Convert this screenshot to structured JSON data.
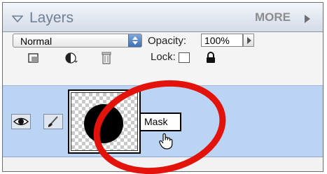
{
  "panel": {
    "title": "Layers",
    "more_label": "MORE",
    "blend_mode": "Normal",
    "opacity_label": "Opacity:",
    "opacity_value": "100%",
    "lock_label": "Lock:"
  },
  "layer": {
    "mask_label": "Mask"
  },
  "colors": {
    "selected_row": "#bcd4f3",
    "annotation_ring": "#e3120b",
    "header_text": "#6f7f96"
  },
  "icons": [
    "collapse-arrow-icon",
    "more-arrow-icon",
    "new-layer-icon",
    "adjustment-layer-icon",
    "trash-icon",
    "lock-transparency-icon",
    "lock-all-icon",
    "eye-icon",
    "brush-icon",
    "hand-cursor-icon"
  ]
}
